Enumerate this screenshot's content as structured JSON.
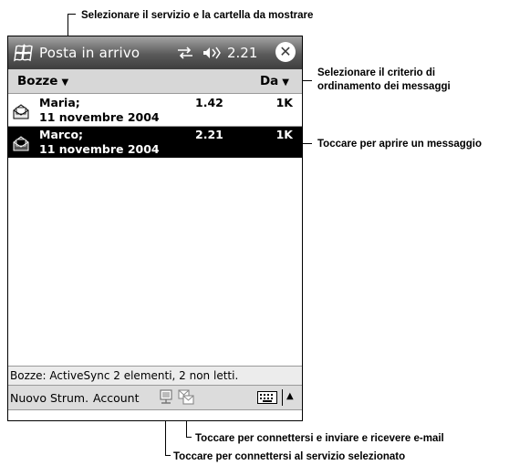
{
  "callouts": {
    "folder_select": "Selezionare il servizio e la cartella da mostrare",
    "sort_line1": "Selezionare il criterio di",
    "sort_line2": "ordinamento dei messaggi",
    "open_message": "Toccare per aprire un messaggio",
    "send_receive": "Toccare per connettersi e inviare e ricevere e-mail",
    "connect_service": "Toccare per connettersi al servizio selezionato"
  },
  "titlebar": {
    "title": "Posta in arrivo",
    "time": "2.21",
    "start_icon": "windows-flag-icon",
    "connectivity_icon": "connectivity-arrows-icon",
    "volume_icon": "speaker-icon",
    "close_symbol": "✕"
  },
  "folderbar": {
    "folder": "Bozze",
    "sort_by": "Da",
    "dropdown_symbol": "▼"
  },
  "messages": [
    {
      "from": "Maria;",
      "date": "11 novembre 2004",
      "time": "1.42",
      "size": "1K",
      "selected": false,
      "icon": "envelope-read-icon"
    },
    {
      "from": "Marco;",
      "date": "11 novembre 2004",
      "time": "2.21",
      "size": "1K",
      "selected": true,
      "icon": "envelope-read-icon"
    }
  ],
  "status": "Bozze: ActiveSync 2 elementi, 2 non letti.",
  "menubar": {
    "items": [
      "Nuovo",
      "Strum.",
      "Account"
    ],
    "connect_icon": "connect-icon",
    "send_receive_icon": "send-receive-icon",
    "keyboard_icon": "keyboard-icon",
    "sip_arrow": "▲"
  },
  "colors": {
    "titlebar": "#4a4a4a",
    "selection": "#000000",
    "bars": "#d7d7d7"
  }
}
